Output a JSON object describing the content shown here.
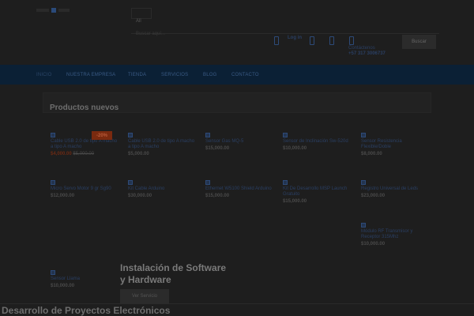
{
  "header": {
    "language_value": "All",
    "search_placeholder": "Buscar aquí...",
    "login_label": "Log in",
    "contact_label": "Contáctenos",
    "contact_phone": "+57 317 3006737",
    "search_button": "Buscar"
  },
  "nav": {
    "items": [
      "INICIO",
      "NUESTRA EMPRESA",
      "TIENDA",
      "SERVICIOS",
      "BLOG",
      "CONTACTO"
    ]
  },
  "section_title": "Productos nuevos",
  "products": [
    {
      "name": "Cable USB 2.0 de tipo A macho a tipo A macho",
      "price": "$4,000.00",
      "old_price": "$5,000.00",
      "badge": "-20%"
    },
    {
      "name": "Cable USB 2.0 de tipo A macho a tipo A macho",
      "price": "$5,000.00"
    },
    {
      "name": "Sensor Gas MQ-5",
      "price": "$15,000.00"
    },
    {
      "name": "Sensor de Inclinación Sw-520d",
      "price": "$10,000.00"
    },
    {
      "name": "Sensor Resistencia Flexible/Doble",
      "price": "$8,000.00"
    },
    {
      "name": "Micro Servo Motor 9 gr Sg90",
      "price": "$12,000.00"
    },
    {
      "name": "Kit Cable Arduino",
      "price": "$30,000.00"
    },
    {
      "name": "Ethernet W5100 Shield Arduino",
      "price": "$15,000.00"
    },
    {
      "name": "Kit De Desarrollo MSP Launch Gratuito",
      "price": "$15,000.00"
    },
    {
      "name": "Registro Universal de Leds",
      "price": "$23,000.00"
    },
    {
      "name": "Módulo RF Transmisor y Receptor 315Mhz",
      "price": "$10,000.00"
    },
    {
      "name": "Sensor Llama",
      "price": "$10,000.00"
    }
  ],
  "promo": {
    "title_line1": "Instalación de Software",
    "title_line2": "y Hardware",
    "button": "Ver Servicio"
  },
  "bottom_heading": "Desarrollo de Proyectos Electrónicos",
  "colors": {
    "background": "#1e1e1e",
    "nav_bar": "#0b2035",
    "badge": "#7a2a0f",
    "link": "#2a3f63"
  }
}
